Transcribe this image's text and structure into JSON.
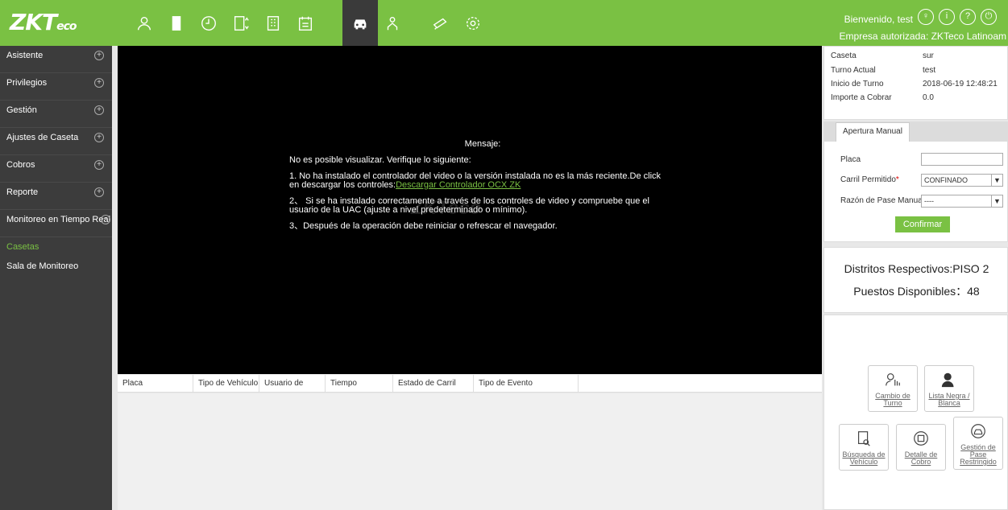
{
  "brand": {
    "logo_main": "ZKT",
    "logo_sub": "eco"
  },
  "header": {
    "welcome": "Bienvenido, test",
    "company": "Empresa autorizada: ZKTeco Latinoam",
    "accent_color": "#7ac143",
    "icons": [
      "user-icon",
      "door-icon",
      "clock-icon",
      "elevator-icon",
      "building-icon",
      "visitor-icon",
      "car-icon",
      "patrol-icon",
      "video-icon",
      "settings-icon"
    ],
    "right_icons": [
      "user-profile-icon",
      "info-icon",
      "help-icon",
      "logout-icon"
    ]
  },
  "sidebar": {
    "items": [
      {
        "label": "Asistente"
      },
      {
        "label": "Privilegios"
      },
      {
        "label": "Gestión"
      },
      {
        "label": "Ajustes de Caseta"
      },
      {
        "label": "Cobros"
      },
      {
        "label": "Reporte"
      },
      {
        "label": "Monitoreo en Tiempo Real"
      }
    ],
    "subitems": [
      {
        "label": "Casetas",
        "active": true
      },
      {
        "label": "Sala de Monitoreo",
        "active": false
      }
    ]
  },
  "video": {
    "title": "Mensaje:",
    "line1": "No es posible visualizar. Verifique lo siguiente:",
    "line2a": "1. No ha instalado el controlador del video o la versión instalada no es la más reciente.De click en descargar los controles:",
    "line2link": "Descargar Controlador OCX ZK",
    "line3": "2、 Si se ha instalado correctamente a través de los controles de video y compruebe que el usuario de la UAC (ajuste a nivel predeterminado o mínimo).",
    "line4": "3、Después de la operación debe reiniciar o refrescar el navegador."
  },
  "grid": {
    "columns": [
      "Placa",
      "Tipo de Vehículo",
      "Usuario de Vehículo",
      "Tiempo",
      "Estado de Carril",
      "Tipo de Evento"
    ]
  },
  "info": {
    "rows": [
      {
        "label": "Caseta",
        "value": "sur"
      },
      {
        "label": "Turno Actual",
        "value": "test"
      },
      {
        "label": "Inicio de Turno",
        "value": "2018-06-19 12:48:21"
      },
      {
        "label": "Importe a Cobrar",
        "value": "0.0"
      }
    ]
  },
  "manual": {
    "tab": "Apertura Manual",
    "placa_label": "Placa",
    "placa_value": "",
    "carril_label": "Carril Permitido",
    "carril_value": "CONFINADO",
    "razon_label": "Razón de Pase Manual",
    "razon_value": "----",
    "confirm": "Confirmar"
  },
  "stats": {
    "distritos": "Distritos Respectivos:PISO 2",
    "puestos": "Puestos Disponibles：48"
  },
  "tiles": {
    "cambio": "Cambio de Turno",
    "lista": "Lista Negra / Blanca",
    "busqueda": "Búsqueda de Vehículo",
    "detalle": "Detalle de Cobro",
    "gestion": "Gestión de Pase Restringido"
  }
}
